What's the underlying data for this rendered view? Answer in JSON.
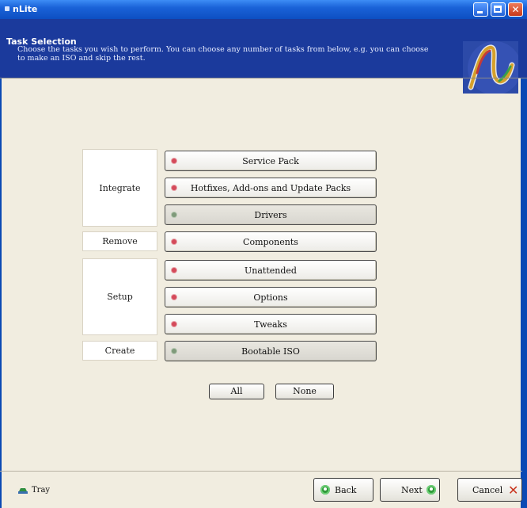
{
  "window": {
    "title": "nLite"
  },
  "header": {
    "title": "Task Selection",
    "description": "Choose the tasks you wish to perform. You can choose any number of tasks from below, e.g. you can choose to make an ISO and skip the rest."
  },
  "categories": [
    {
      "label": "Integrate"
    },
    {
      "label": "Remove"
    },
    {
      "label": "Setup"
    },
    {
      "label": "Create"
    }
  ],
  "tasks": [
    {
      "label": "Service Pack",
      "enabled": true
    },
    {
      "label": "Hotfixes, Add-ons and Update Packs",
      "enabled": true
    },
    {
      "label": "Drivers",
      "enabled": false
    },
    {
      "label": "Components",
      "enabled": true
    },
    {
      "label": "Unattended",
      "enabled": true
    },
    {
      "label": "Options",
      "enabled": true
    },
    {
      "label": "Tweaks",
      "enabled": true
    },
    {
      "label": "Bootable ISO",
      "enabled": false
    }
  ],
  "selection": {
    "all_label": "All",
    "none_label": "None"
  },
  "footer": {
    "tray_label": "Tray",
    "back_label": "Back",
    "next_label": "Next",
    "cancel_label": "Cancel"
  },
  "colors": {
    "title_bar": "#1a62d8",
    "header_band": "#1b3a9c",
    "window_bg": "#f1ede0",
    "enabled_dot": "#d44a5a",
    "disabled_dot": "#7f9a7a",
    "go_icon": "#2f9a3a",
    "cancel_icon": "#c8331d"
  },
  "icons": {
    "app": "nlite-app-icon",
    "logo": "nlite-logo",
    "back": "green-circle-icon",
    "next": "green-circle-icon",
    "cancel": "red-x-icon",
    "tray": "tray-icon"
  }
}
